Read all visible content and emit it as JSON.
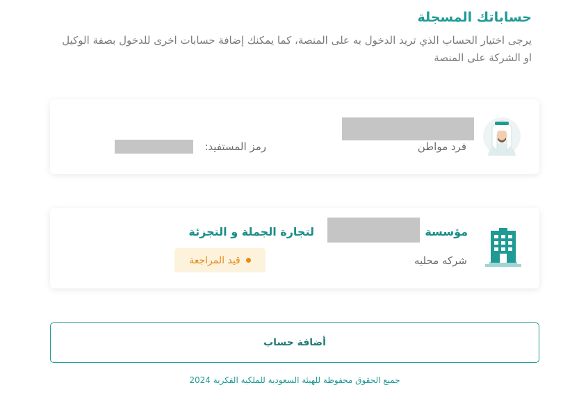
{
  "header": {
    "title": "حساباتك المسجلة",
    "description": "يرجى اختيار الحساب الذي تريد الدخول به على المنصة، كما يمكنك إضافة حسابات اخرى للدخول بصفة الوكيل او الشركة على المنصة"
  },
  "accounts": [
    {
      "avatar_icon": "citizen-avatar-icon",
      "type": "فرد مواطن",
      "beneficiary_code_label": "رمز المستفيد:"
    },
    {
      "avatar_icon": "building-icon",
      "name_prefix": "مؤسسة",
      "name_suffix": "لتجارة الجملة و التجزئة",
      "type": "شركه محليه",
      "status": "قيد المراجعة"
    }
  ],
  "add_account_button": "أضافة حساب",
  "footer": "جميع الحقوق محفوظة للهيئة السعودية للملكية الفكرية 2024",
  "colors": {
    "primary": "#1f9a94",
    "status_bg": "#fdf2dc",
    "status_text": "#e3891a"
  }
}
